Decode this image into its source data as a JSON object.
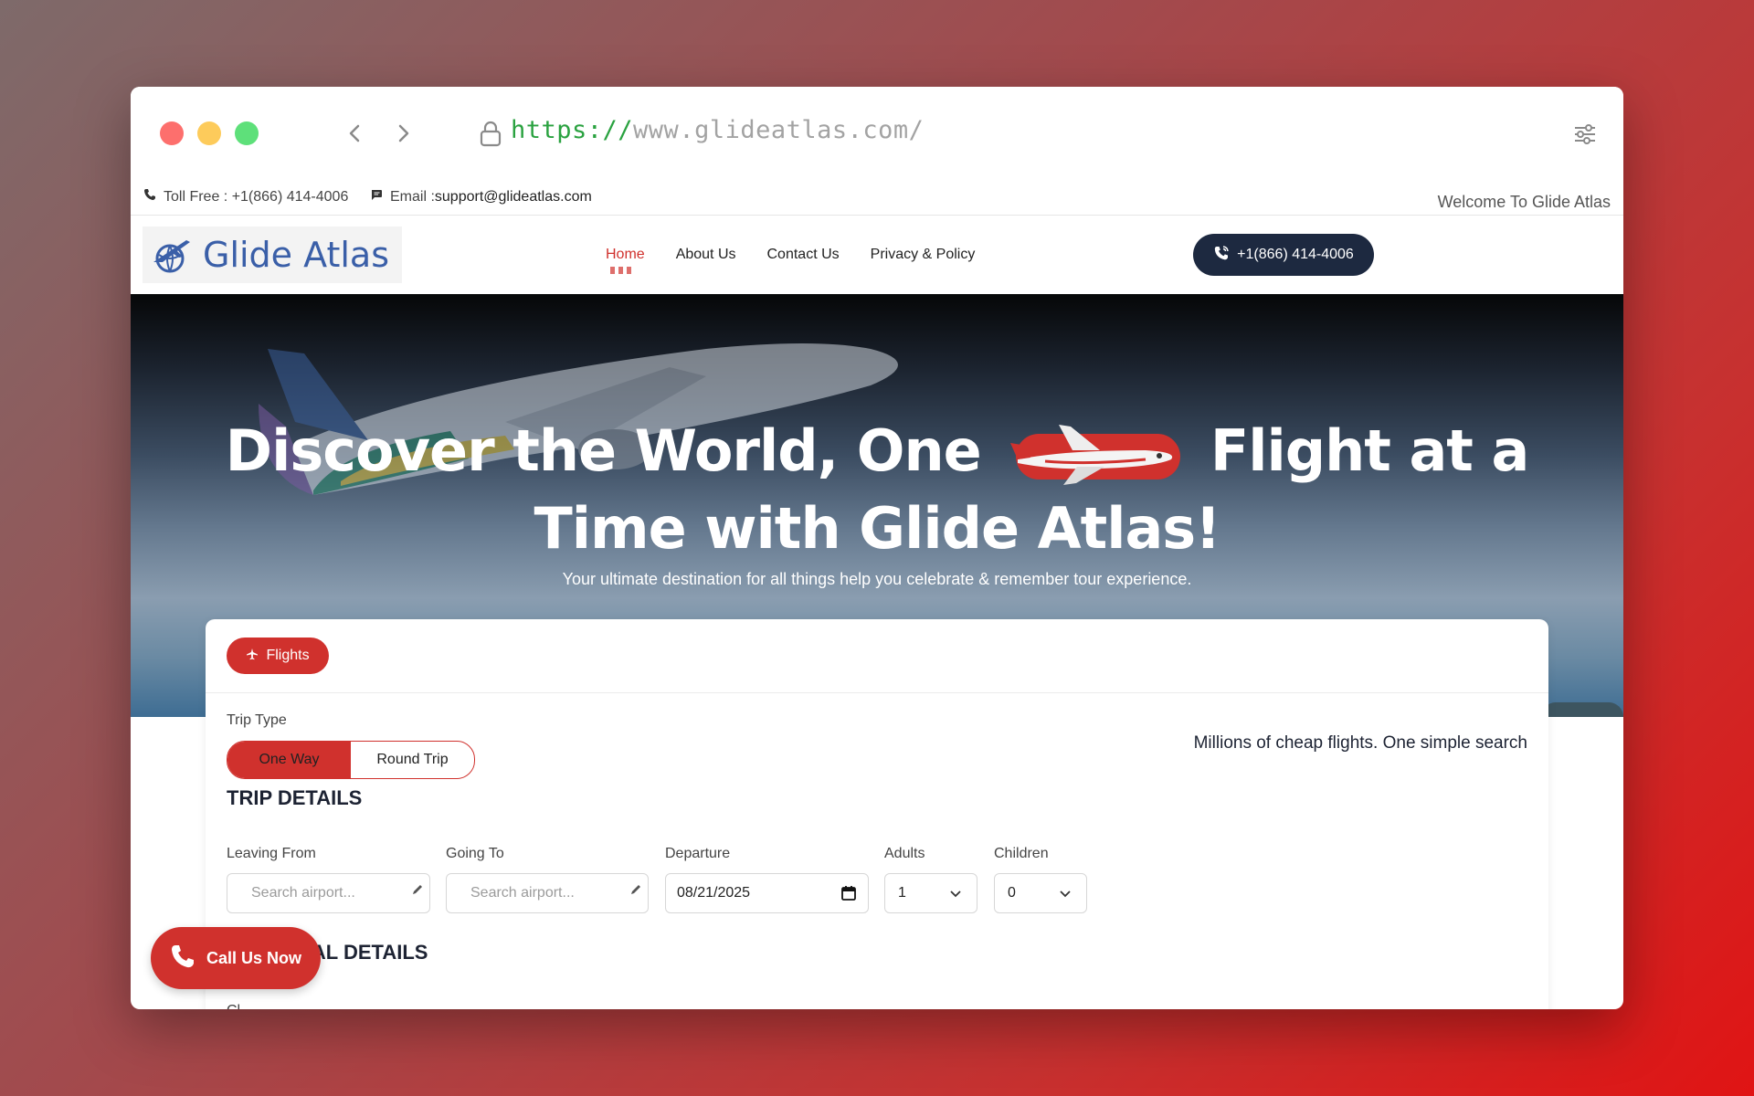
{
  "browser": {
    "url_scheme": "https://",
    "url_host": "www.glideatlas.com/"
  },
  "topbar": {
    "toll_free": "Toll Free : +1(866) 414-4006",
    "email_label": "Email :",
    "email_value": "support@glideatlas.com",
    "welcome": "Welcome To Glide Atlas"
  },
  "header": {
    "logo_text": "Glide Atlas",
    "menu": [
      "Home",
      "About Us",
      "Contact Us",
      "Privacy & Policy"
    ],
    "phone_button": "+1(866) 414-4006"
  },
  "hero": {
    "title_line1_part1": "Discover the World, One",
    "title_line1_part2": "Flight at a",
    "title_line2": "Time with Glide Atlas!",
    "subtitle": "Your ultimate destination for all things help you celebrate & remember tour experience."
  },
  "search": {
    "tab_flights": "Flights",
    "trip_type_label": "Trip Type",
    "trip_options": [
      "One Way",
      "Round Trip"
    ],
    "tagline": "Millions of cheap flights. One simple search",
    "trip_details_title": "TRIP DETAILS",
    "leaving_from_label": "Leaving From",
    "leaving_from_placeholder": "Search airport...",
    "going_to_label": "Going To",
    "going_to_placeholder": "Search airport...",
    "departure_label": "Departure",
    "departure_value": "08/21/2025",
    "adults_label": "Adults",
    "adults_value": "1",
    "children_label": "Children",
    "children_value": "0",
    "personal_details_title": "PERSONAL DETAILS",
    "next_label_partial": "Cl"
  },
  "float_call": {
    "label": "Call Us Now"
  },
  "colors": {
    "accent": "#d0312d",
    "navy": "#1d2940",
    "url_scheme": "#2aa240"
  }
}
